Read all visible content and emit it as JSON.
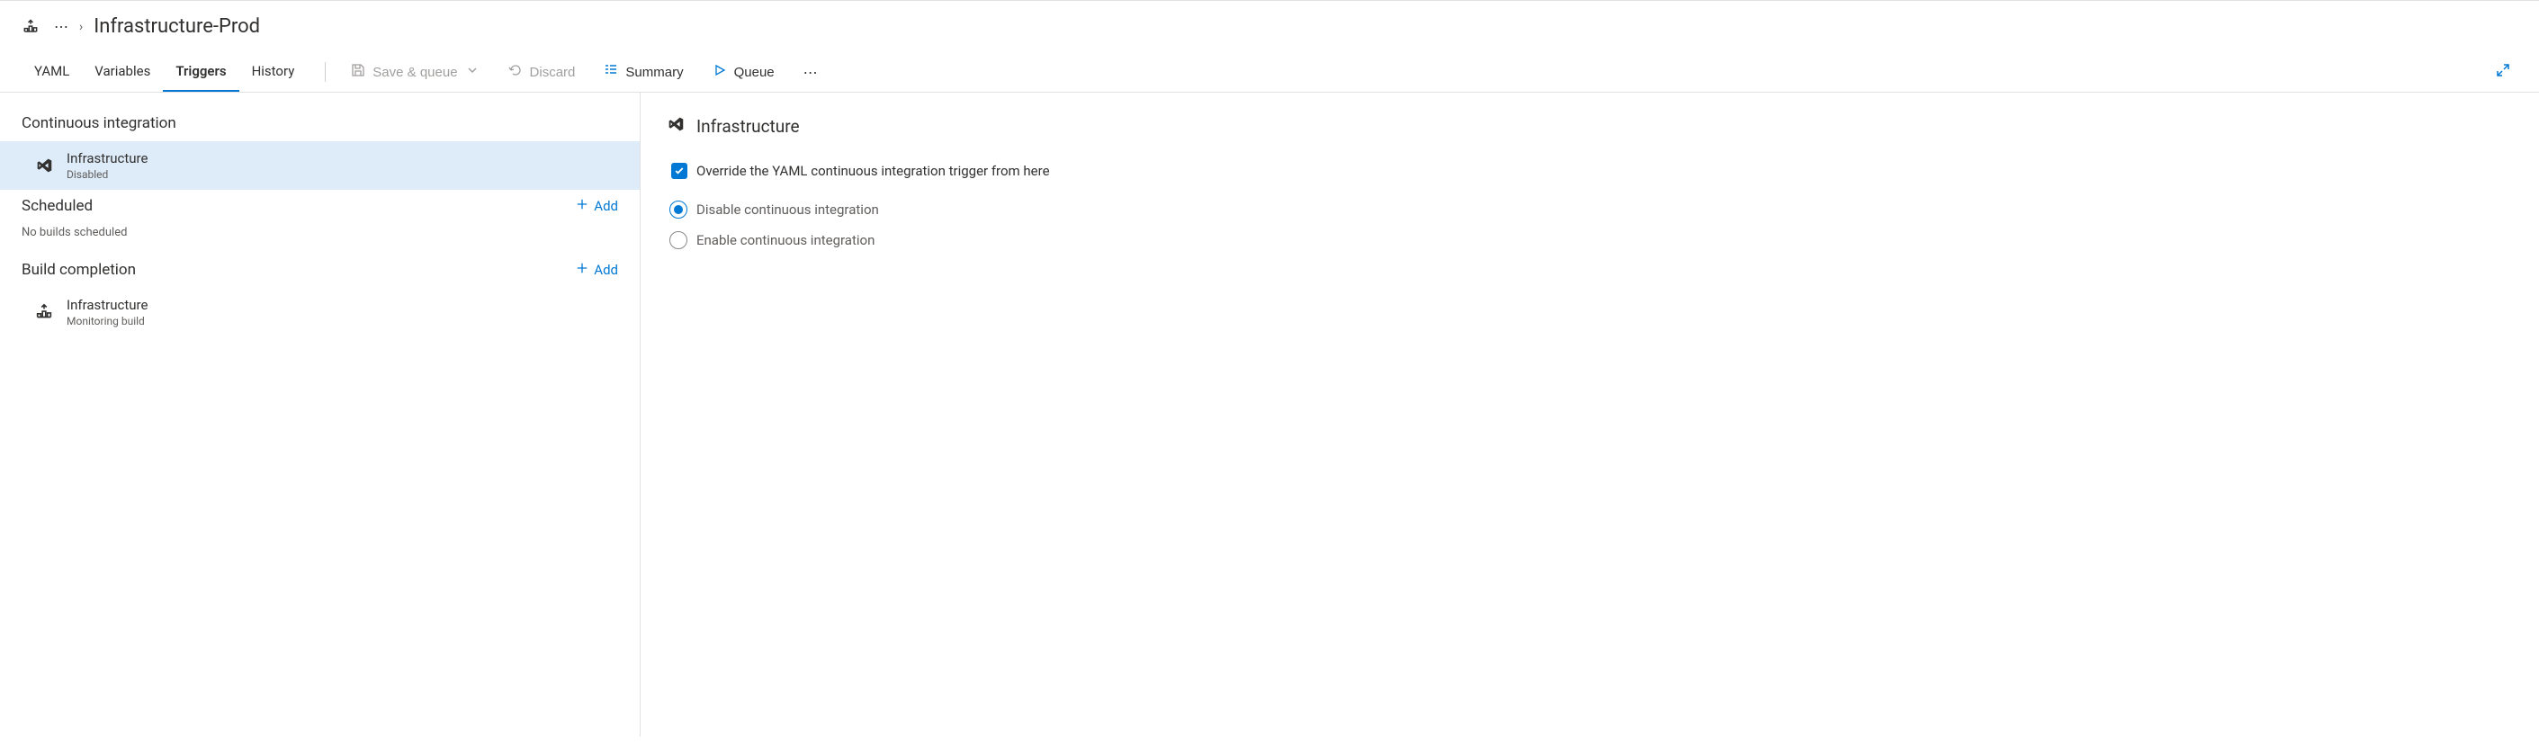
{
  "breadcrumb": {
    "title": "Infrastructure-Prod"
  },
  "tabs": {
    "yaml": "YAML",
    "variables": "Variables",
    "triggers": "Triggers",
    "history": "History"
  },
  "toolbar": {
    "save_queue": "Save & queue",
    "discard": "Discard",
    "summary": "Summary",
    "queue": "Queue"
  },
  "left": {
    "ci_header": "Continuous integration",
    "ci_item": {
      "title": "Infrastructure",
      "subtitle": "Disabled"
    },
    "scheduled_header": "Scheduled",
    "scheduled_empty": "No builds scheduled",
    "add_label": "Add",
    "build_completion_header": "Build completion",
    "bc_item": {
      "title": "Infrastructure",
      "subtitle": "Monitoring build"
    }
  },
  "right": {
    "title": "Infrastructure",
    "override_label": "Override the YAML continuous integration trigger from here",
    "disable_label": "Disable continuous integration",
    "enable_label": "Enable continuous integration"
  }
}
